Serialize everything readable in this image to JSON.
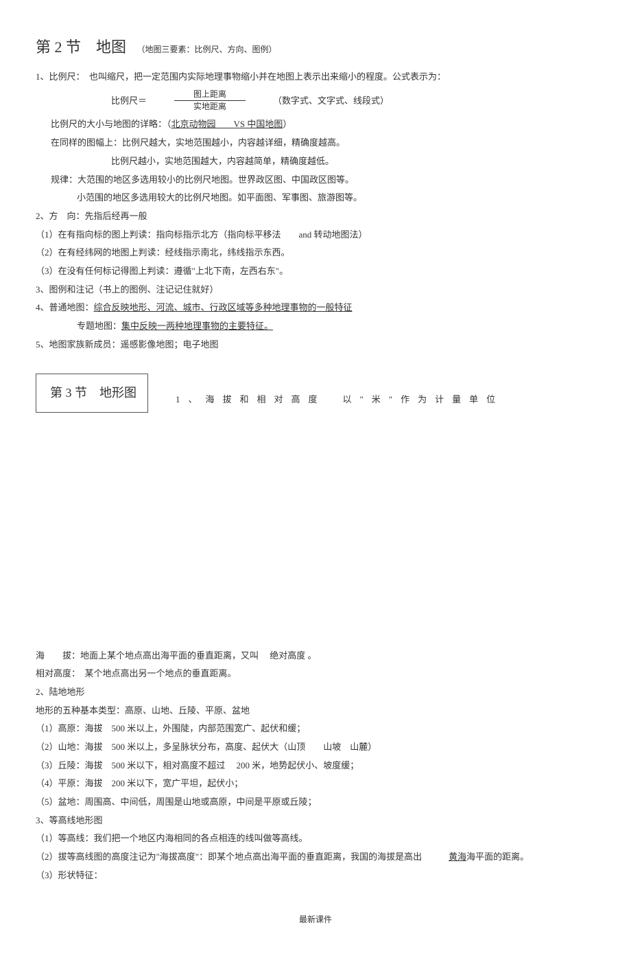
{
  "s2": {
    "title": "第 2 节　地图",
    "title_sub": "（地图三要素：比例尺、方向、图例）",
    "n1": "1、比例尺：　也叫缩尺，把一定范围内实际地理事物缩小并在地图上表示出来缩小的程度。公式表示为：",
    "scale_label": "比例尺＝",
    "scale_top": "图上距离",
    "scale_bot": "实地距离",
    "scale_types": "（数字式、文字式、线段式）",
    "n1a": "比例尺的大小与地图的详略：（",
    "n1a_u": "北京动物园　　VS 中国地图",
    "n1a_end": "）",
    "n1b": "在同样的图幅上：比例尺越大，实地范围越小，内容越详细，精确度越高。",
    "n1c": "比例尺越小，实地范围越大，内容越简单，精确度越低。",
    "n1d": "规律：大范围的地区多选用较小的比例尺地图。世界政区图、中国政区图等。",
    "n1e": "小范围的地区多选用较大的比例尺地图。如平面图、军事图、旅游图等。",
    "n2": "2、方　向：先指后经再一般",
    "n2a": "（1）在有指向标的图上判读：指向标指示北方（指向标平移法　　and 转动地图法）",
    "n2b": "（2）在有经纬网的地图上判读：经线指示南北，纬线指示东西。",
    "n2c": "（3）在没有任何标记得图上判读：遵循\"上北下南，左西右东\"。",
    "n3": "3、图例和注记（书上的图例、注记记住就好）",
    "n4a": "4、普通地图：",
    "n4a_u": "综合反映地形、河流、城市、行政区域等多种地理事物的一般特征",
    "n4b": "专题地图：",
    "n4b_u": "集中反映一两种地理事物的主要特征。",
    "n5": "5、地图家族新成员：遥感影像地图；电子地图"
  },
  "s3": {
    "box_title": "第 3 节　地形图",
    "intro": "1、海拔和相对高度　以\"米\"作为计量单位",
    "a1_label": "海　　拔：",
    "a1_text": "地面上某个地点高出海平面的垂直距离，又叫　 绝对高度 。",
    "a2_label": "相对高度：",
    "a2_text": "　某个地点高出另一个地点的垂直距离。",
    "b0": "2、陆地地形",
    "b0a": "地形的五种基本类型：高原、山地、丘陵、平原、盆地",
    "b1": "（1）高原：海拔　500 米以上，外围陡，内部范围宽广、起伏和缓；",
    "b2": "（2）山地：海拔　500 米以上，多呈脉状分布，高度、起伏大（山顶　　山坡　山麓）",
    "b3": "（3）丘陵：海拔　500 米以下，相对高度不超过　 200 米，地势起伏小、坡度缓；",
    "b4": "（4）平原：海拔　200 米以下，宽广平坦，起伏小；",
    "b5": "（5）盆地：周围高、中间低，周围是山地或高原，中间是平原或丘陵；",
    "c0": "3、等高线地形图",
    "c1": "（1）等高线：我们把一个地区内海相同的各点相连的线叫做等高线。",
    "c2a": "（2）拔等高线图的高度注记为\"海拔高度\"：即某个地点高出海平面的垂直距离，我国的海拔是高出　　　",
    "c2_u": "黄海",
    "c2b": "海平面的距离。",
    "c3": "（3）形状特征："
  },
  "footer": "最新课件"
}
